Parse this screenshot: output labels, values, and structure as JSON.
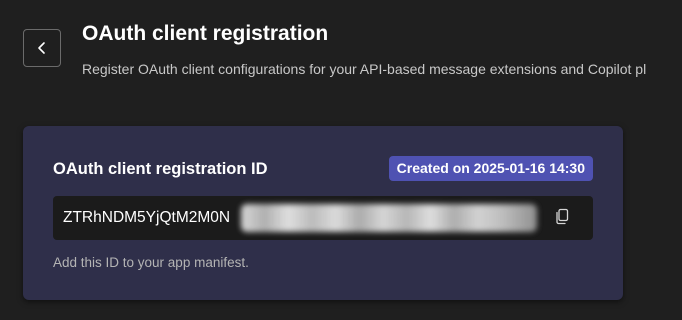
{
  "header": {
    "back_icon": "chevron-left-icon",
    "title": "OAuth client registration",
    "subtitle": "Register OAuth client configurations for your API-based message extensions and Copilot pl"
  },
  "card": {
    "title": "OAuth client registration ID",
    "badge": "Created on 2025-01-16 14:30",
    "badge_color": "#4f52b2",
    "background_color": "#2f2f4a",
    "id_value_visible": "ZTRhNDM5YjQtM2M0N",
    "id_value_redacted": true,
    "copy_icon": "copy-icon",
    "helper": "Add this ID to your app manifest."
  },
  "theme": {
    "page_background": "#1f1f1f",
    "field_background": "#1b1b1b"
  }
}
